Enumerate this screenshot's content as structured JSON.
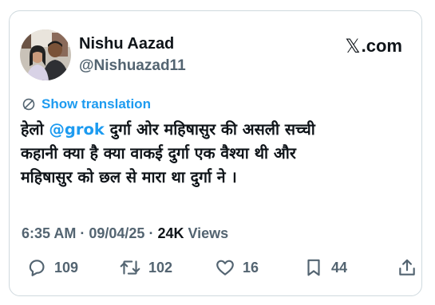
{
  "author": {
    "display_name": "Nishu Aazad",
    "handle": "@Nishuazad11"
  },
  "site": {
    "logo_text": ".com",
    "logo_icon": "x-logo-icon"
  },
  "translation": {
    "label": "Show translation",
    "icon": "globe-slash-icon"
  },
  "tweet": {
    "line1_start": "हेलो ",
    "mention": "@grok",
    "line1_end": " दुर्गा ओर महिषासुर की असली सच्ची",
    "line2": "कहानी क्या है  क्या वाकई दुर्गा एक वैश्या थी और",
    "line3": "महिषासुर को छल से मारा था दुर्गा ने ।"
  },
  "meta": {
    "time": "6:35 AM",
    "separator": "·",
    "date": "09/04/25",
    "views_count": "24K",
    "views_label": "Views"
  },
  "actions": {
    "reply": {
      "count": "109",
      "icon": "reply-icon"
    },
    "retweet": {
      "count": "102",
      "icon": "retweet-icon"
    },
    "like": {
      "count": "16",
      "icon": "heart-icon"
    },
    "bookmark": {
      "count": "44",
      "icon": "bookmark-icon"
    },
    "share": {
      "icon": "share-icon"
    }
  },
  "colors": {
    "link": "#1d9bf0",
    "text": "#0f1419",
    "muted": "#536471",
    "border": "#cfd9de"
  }
}
